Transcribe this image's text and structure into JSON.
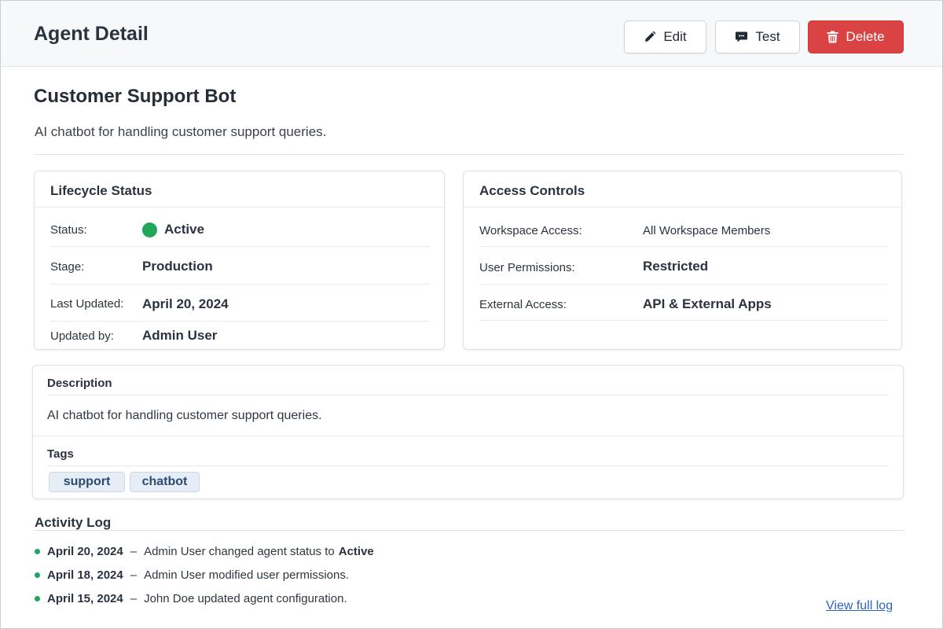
{
  "header": {
    "title": "Agent Detail",
    "edit_label": "Edit",
    "test_label": "Test",
    "delete_label": "Delete"
  },
  "agent": {
    "name": "Customer Support Bot",
    "summary": "AI chatbot for handling customer support queries."
  },
  "lifecycle": {
    "title": "Lifecycle Status",
    "rows": [
      {
        "label": "Status:",
        "value": "Active"
      },
      {
        "label": "Stage:",
        "value": "Production"
      },
      {
        "label": "Last Updated:",
        "value": "April 20, 2024"
      },
      {
        "label": "Updated by:",
        "value": "Admin User"
      }
    ]
  },
  "access": {
    "title": "Access Controls",
    "rows": [
      {
        "label": "Workspace Access:",
        "value": "All Workspace Members"
      },
      {
        "label": "User Permissions:",
        "value": "Restricted"
      },
      {
        "label": "External Access:",
        "value": "API & External Apps"
      }
    ]
  },
  "details": {
    "description_label": "Description",
    "description_text": "AI chatbot for handling customer support queries.",
    "tags_label": "Tags",
    "tags": [
      "support",
      "chatbot"
    ]
  },
  "activity": {
    "title": "Activity Log",
    "items": [
      {
        "date": "April 20, 2024",
        "dash": "–",
        "text": "Admin User changed agent status to",
        "status": "Active"
      },
      {
        "date": "April 18, 2024",
        "dash": "–",
        "text": "Admin User modified user permissions."
      },
      {
        "date": "April 15, 2024",
        "dash": "–",
        "text": "John Doe updated agent configuration."
      }
    ],
    "view_full_label": "View full log"
  },
  "colors": {
    "accent_red": "#d94343",
    "status_green": "#22a65a",
    "link_blue": "#2a64c2",
    "tag_bg": "#e6edf6"
  },
  "icons": {
    "edit": "pencil-icon",
    "test": "chat-bubble-icon",
    "delete": "trash-icon",
    "status": "status-dot-icon"
  }
}
